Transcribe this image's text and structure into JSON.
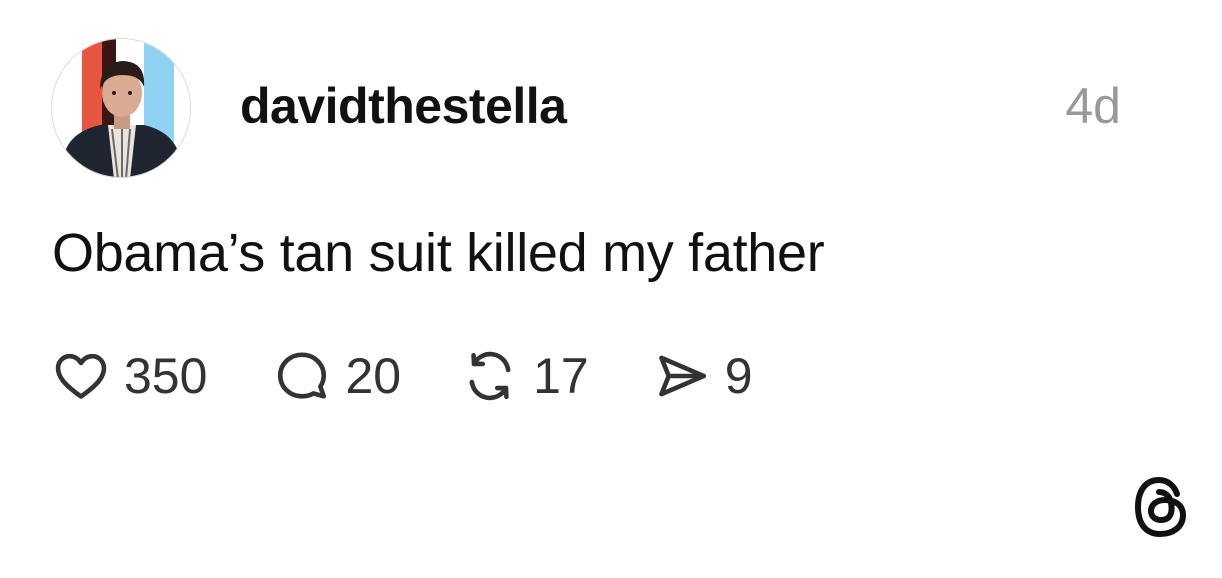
{
  "post": {
    "username": "davidthestella",
    "timestamp": "4d",
    "text": "Obama’s tan suit killed my father"
  },
  "actions": {
    "like_count": "350",
    "reply_count": "20",
    "repost_count": "17",
    "share_count": "9"
  },
  "icons": {
    "like": "heart-icon",
    "reply": "speech-bubble-icon",
    "repost": "repost-arrows-icon",
    "share": "paper-plane-icon",
    "brand": "threads-logo-icon"
  },
  "colors": {
    "text": "#111111",
    "muted": "#999999",
    "count": "#333333",
    "avatar_red": "#e8563f",
    "avatar_blue": "#8fd3f4"
  }
}
